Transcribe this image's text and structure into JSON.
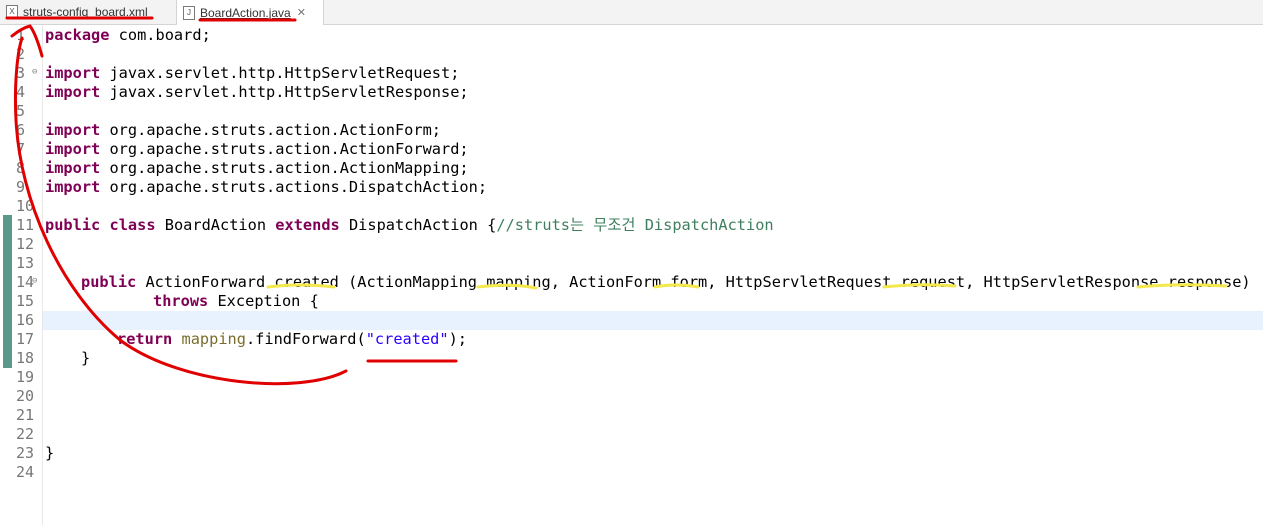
{
  "tabs": [
    {
      "label": "struts-config_board.xml",
      "icon": "xml-file-icon"
    },
    {
      "label": "BoardAction.java",
      "icon": "java-file-icon"
    }
  ],
  "editor": {
    "line_numbers": [
      "1",
      "2",
      "3",
      "4",
      "5",
      "6",
      "7",
      "8",
      "9",
      "10",
      "11",
      "12",
      "13",
      "14",
      "15",
      "16",
      "17",
      "18",
      "19",
      "20",
      "21",
      "22",
      "23",
      "24"
    ],
    "lines": {
      "l1": {
        "kw": "package",
        "rest": " com.board;"
      },
      "l3": {
        "kw": "import",
        "rest": " javax.servlet.http.HttpServletRequest;"
      },
      "l4": {
        "kw": "import",
        "rest": " javax.servlet.http.HttpServletResponse;"
      },
      "l6": {
        "kw": "import",
        "rest": " org.apache.struts.action.ActionForm;"
      },
      "l7": {
        "kw": "import",
        "rest": " org.apache.struts.action.ActionForward;"
      },
      "l8": {
        "kw": "import",
        "rest": " org.apache.struts.action.ActionMapping;"
      },
      "l9": {
        "kw": "import",
        "rest": " org.apache.struts.actions.DispatchAction;"
      },
      "l11": {
        "kw1": "public",
        "kw2": "class",
        "name": " BoardAction ",
        "kw3": "extends",
        "rest": " DispatchAction {",
        "comment": "//struts는 무조건 DispatchAction"
      },
      "l14": {
        "kw": "public",
        "rest": " ActionForward created (ActionMapping mapping, ActionForm form, HttpServletRequest request, HttpServletResponse response)"
      },
      "l15": {
        "kw": "throws",
        "rest": " Exception {"
      },
      "l17": {
        "kw": "return",
        "fld": "mapping",
        "rest": ".findForward(",
        "str": "\"created\"",
        "end": ");"
      },
      "l18": {
        "rest": "}"
      },
      "l23": {
        "rest": "}"
      }
    }
  },
  "colors": {
    "keyword": "#7f0055",
    "string": "#2a00ff",
    "comment": "#3f7f5f",
    "annotation": "#e00000",
    "highlight": "#f5e84a"
  }
}
